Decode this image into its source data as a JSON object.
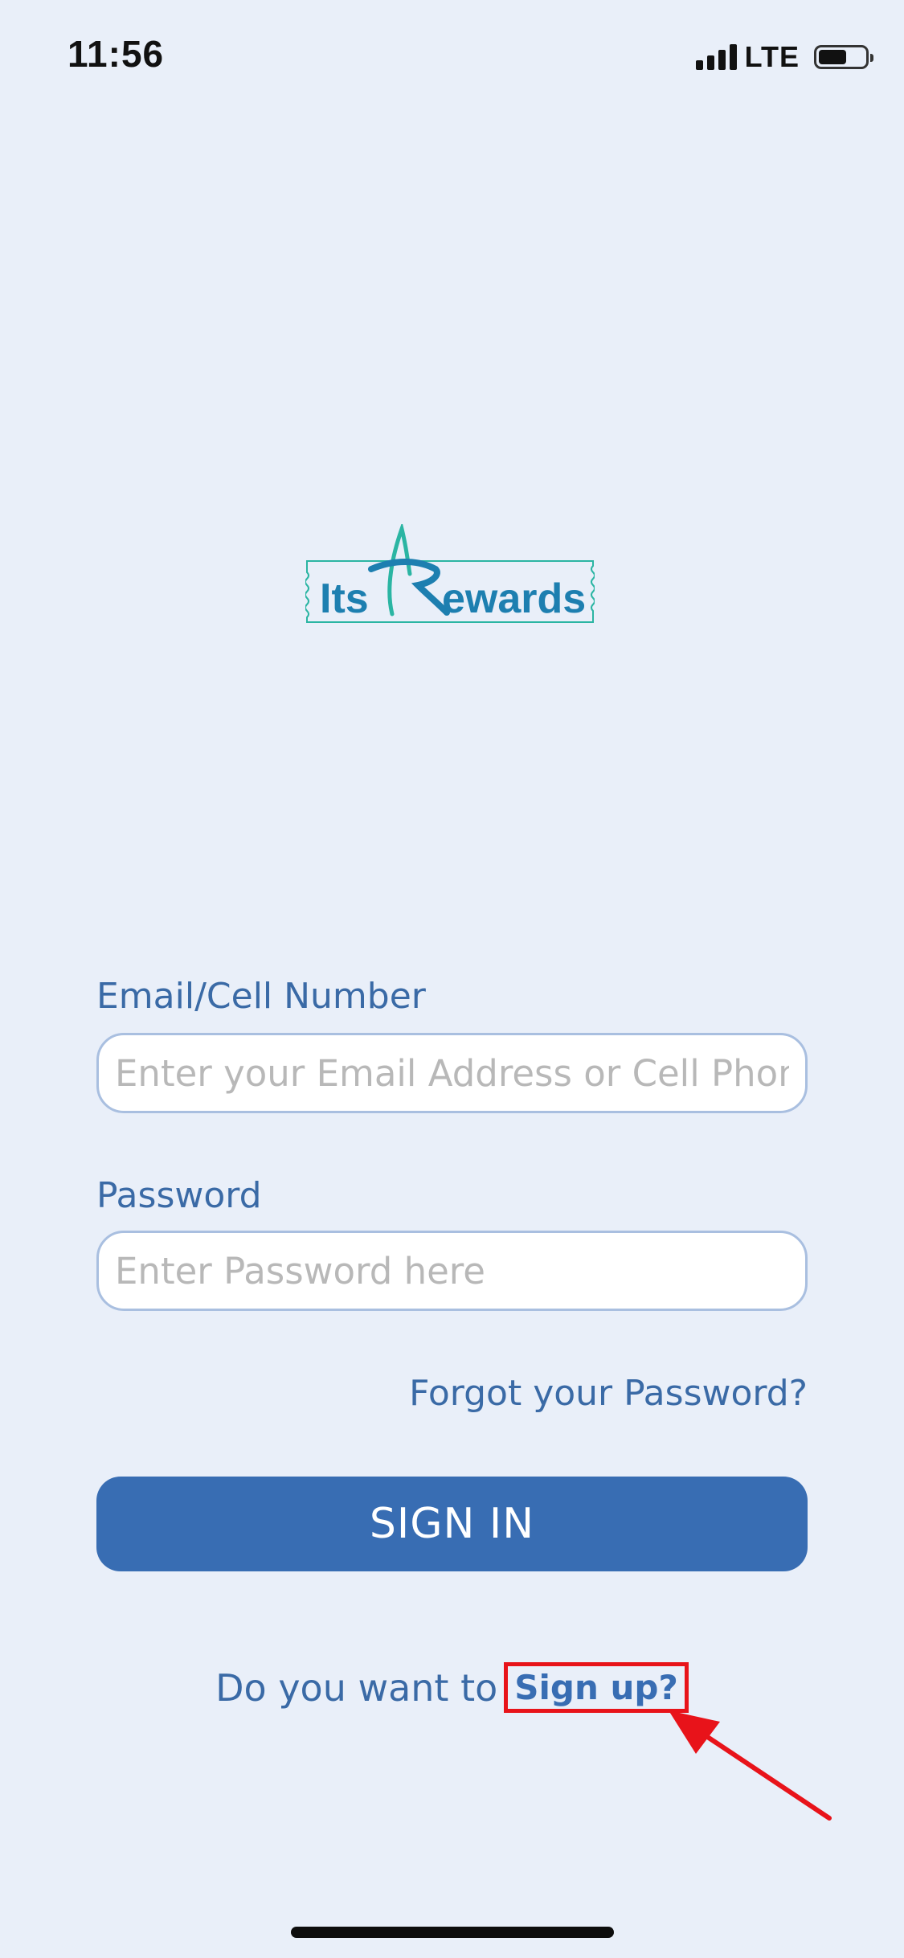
{
  "status_bar": {
    "time": "11:56",
    "network": "LTE",
    "signal_bars": 4,
    "battery_level": 0.6
  },
  "logo": {
    "text_left": "Its",
    "text_right": "ewards",
    "brand_color": "#1d7fb0",
    "accent_color": "#2bb5a3"
  },
  "form": {
    "email_label": "Email/Cell Number",
    "email_placeholder": "Enter your Email Address or Cell Phone",
    "email_value": "",
    "password_label": "Password",
    "password_placeholder": "Enter Password here",
    "password_value": "",
    "forgot_link": "Forgot your Password?",
    "signin_button": "SIGN IN",
    "signup_prompt": "Do you want to",
    "signup_link": "Sign up?"
  },
  "colors": {
    "background": "#e9eff9",
    "primary": "#386db3",
    "label_text": "#3a6aa6",
    "highlight": "#e8131a"
  }
}
